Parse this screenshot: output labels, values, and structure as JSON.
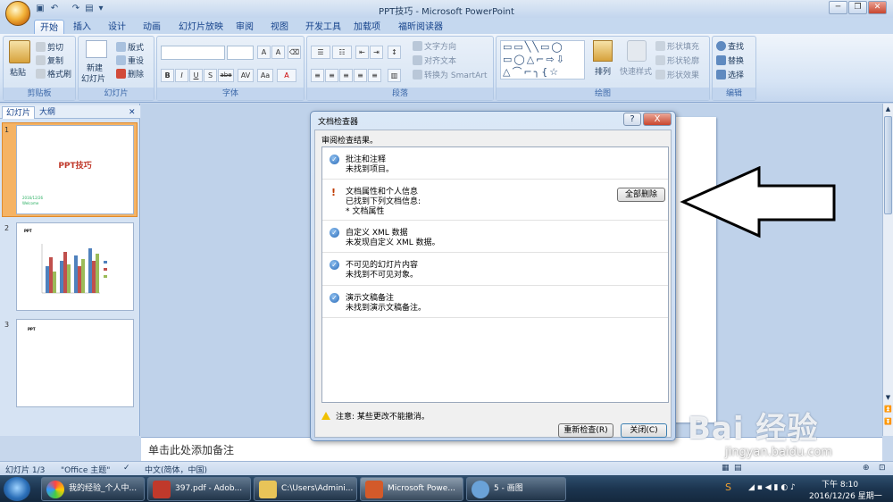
{
  "window": {
    "title": "PPT技巧 - Microsoft PowerPoint"
  },
  "tabs": [
    "开始",
    "插入",
    "设计",
    "动画",
    "幻灯片放映",
    "审阅",
    "视图",
    "开发工具",
    "加载项",
    "福昕阅读器"
  ],
  "ribbon": {
    "clipboard": {
      "paste": "粘贴",
      "cut": "剪切",
      "copy": "复制",
      "format_painter": "格式刷",
      "label": "剪贴板"
    },
    "slides": {
      "new_slide": "新建",
      "new_slide2": "幻灯片",
      "layout": "版式",
      "reset": "重设",
      "delete": "删除",
      "label": "幻灯片"
    },
    "font": {
      "label": "字体",
      "buttons": [
        "B",
        "I",
        "U",
        "S",
        "abe",
        "AV",
        "Aa",
        "A"
      ]
    },
    "paragraph": {
      "text_direction": "文字方向",
      "align_text": "对齐文本",
      "smartart": "转换为 SmartArt",
      "label": "段落"
    },
    "drawing": {
      "arrange": "排列",
      "quick_styles": "快速样式",
      "shape_fill": "形状填充",
      "shape_outline": "形状轮廓",
      "shape_effects": "形状效果",
      "label": "绘图"
    },
    "editing": {
      "find": "查找",
      "replace": "替换",
      "select": "选择",
      "label": "编辑"
    }
  },
  "left_pane": {
    "tabs": [
      "幻灯片",
      "大纲"
    ],
    "slides": [
      {
        "num": "1",
        "title": "PPT技巧",
        "date": "2016/12/26",
        "sub": "Welcome"
      },
      {
        "num": "2",
        "title": "PPT"
      },
      {
        "num": "3",
        "title": "PPT"
      }
    ]
  },
  "notes_placeholder": "单击此处添加备注",
  "dialog": {
    "title": "文档检查器",
    "subtitle": "审阅检查结果。",
    "items": [
      {
        "title": "批注和注释",
        "detail": "未找到项目。",
        "status": "ok"
      },
      {
        "title": "文档属性和个人信息",
        "detail": "已找到下列文档信息:",
        "extra": "* 文档属性",
        "status": "warn",
        "action": "全部删除"
      },
      {
        "title": "自定义 XML 数据",
        "detail": "未发现自定义 XML 数据。",
        "status": "ok"
      },
      {
        "title": "不可见的幻灯片内容",
        "detail": "未找到不可见对象。",
        "status": "ok"
      },
      {
        "title": "演示文稿备注",
        "detail": "未找到演示文稿备注。",
        "status": "ok"
      }
    ],
    "note": "注意: 某些更改不能撤消。",
    "recheck": "重新检查(R)",
    "close": "关闭(C)",
    "help": "?",
    "x": "X"
  },
  "statusbar": {
    "slide": "幻灯片 1/3",
    "theme": "\"Office 主题\"",
    "lang": "中文(简体，中国)"
  },
  "taskbar": {
    "items": [
      "我的经验_个人中...",
      "397.pdf - Adob...",
      "C:\\Users\\Admini...",
      "Microsoft Powe...",
      "5 - 画图"
    ],
    "clock_time": "下午 8:10",
    "clock_date": "2016/12/26 星期一"
  },
  "watermark": {
    "text": "Bai 经验",
    "url": "jingyan.baidu.com"
  },
  "colors": {
    "accent": "#c0392b",
    "ribbon": "#d6e4f5",
    "taskbar": "#1c3550"
  }
}
